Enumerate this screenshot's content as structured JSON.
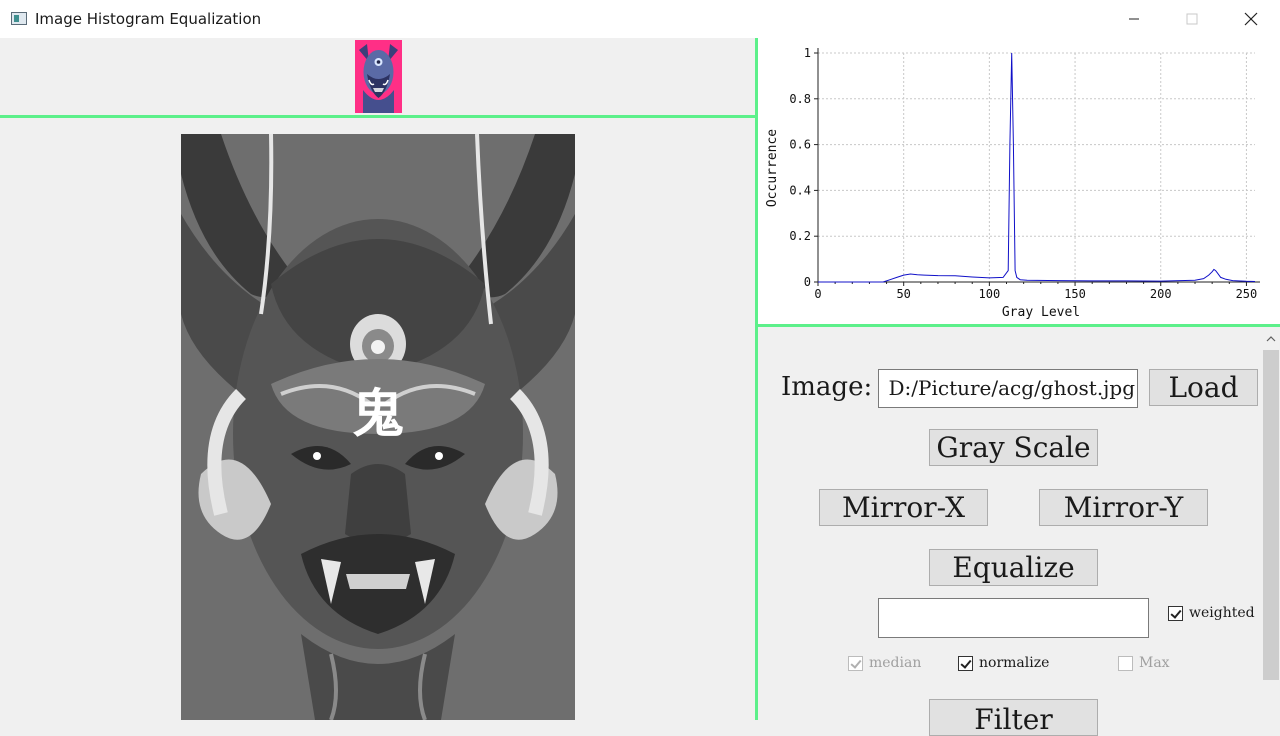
{
  "window": {
    "title": "Image Histogram Equalization",
    "icons": [
      "app-icon",
      "minimize-icon",
      "maximize-icon",
      "close-icon"
    ]
  },
  "images": {
    "thumbnail_bg": "#ff2f86",
    "main_bg": "#6e6e6e",
    "kanji": "鬼"
  },
  "histogram": {
    "xlabel": "Gray Level",
    "ylabel": "Occurrence"
  },
  "chart_data": {
    "type": "line",
    "xlabel": "Gray Level",
    "ylabel": "Occurrence",
    "xlim": [
      0,
      255
    ],
    "ylim": [
      0,
      1
    ],
    "xticks": [
      "0",
      "50",
      "100",
      "150",
      "200",
      "250"
    ],
    "yticks": [
      "0",
      "0.2",
      "0.4",
      "0.6",
      "0.8",
      "1"
    ],
    "grid": true,
    "color": "#1010c8",
    "series": [
      {
        "x": [
          0,
          38,
          42,
          46,
          50,
          54,
          58,
          62,
          70,
          80,
          90,
          100,
          108,
          111,
          112,
          113,
          114,
          115,
          116,
          118,
          122,
          140,
          160,
          180,
          200,
          220,
          225,
          228,
          230,
          231,
          232,
          233,
          235,
          238,
          242,
          250,
          255
        ],
        "y": [
          0,
          0,
          0.01,
          0.02,
          0.03,
          0.035,
          0.032,
          0.03,
          0.028,
          0.027,
          0.022,
          0.018,
          0.02,
          0.05,
          0.6,
          1.0,
          0.6,
          0.05,
          0.02,
          0.01,
          0.008,
          0.006,
          0.005,
          0.005,
          0.004,
          0.008,
          0.015,
          0.03,
          0.045,
          0.055,
          0.05,
          0.04,
          0.02,
          0.012,
          0.006,
          0.003,
          0.002
        ]
      }
    ]
  },
  "controls": {
    "image_label": "Image:",
    "path_value": "D:/Picture/acg/ghost.jpg",
    "load_label": "Load",
    "gray_scale_label": "Gray Scale",
    "mirror_x_label": "Mirror-X",
    "mirror_y_label": "Mirror-Y",
    "equalize_label": "Equalize",
    "filter_text_value": "",
    "weighted_label": "weighted",
    "weighted_checked": true,
    "median_label": "median",
    "median_checked": true,
    "normalize_label": "normalize",
    "normalize_checked": true,
    "max_label": "Max",
    "max_checked": false,
    "filter_label": "Filter"
  },
  "colors": {
    "separator": "#5cf08a",
    "histogram_line": "#1010c8"
  }
}
